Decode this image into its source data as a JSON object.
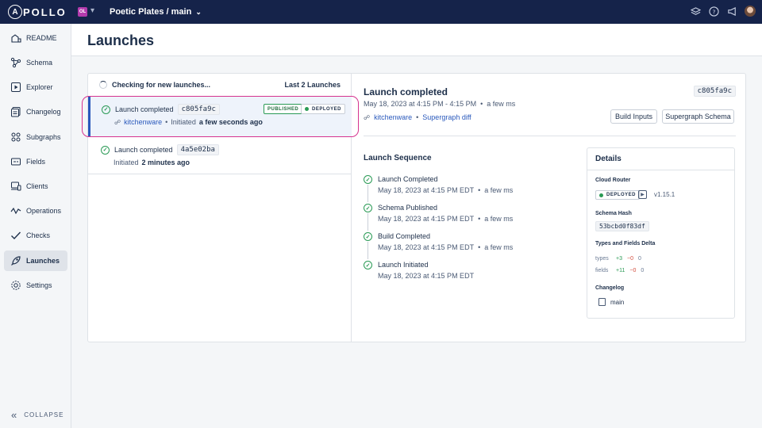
{
  "brand": {
    "logo_letter": "A",
    "logo_text": "POLLO"
  },
  "org": {
    "initials": "OL"
  },
  "graph": {
    "name": "Poetic Plates / main"
  },
  "sidebar": {
    "items": [
      {
        "label": "README",
        "icon": "readme-icon"
      },
      {
        "label": "Schema",
        "icon": "schema-icon"
      },
      {
        "label": "Explorer",
        "icon": "explorer-icon"
      },
      {
        "label": "Changelog",
        "icon": "changelog-icon"
      },
      {
        "label": "Subgraphs",
        "icon": "subgraphs-icon"
      },
      {
        "label": "Fields",
        "icon": "fields-icon"
      },
      {
        "label": "Clients",
        "icon": "clients-icon"
      },
      {
        "label": "Operations",
        "icon": "operations-icon"
      },
      {
        "label": "Checks",
        "icon": "checks-icon"
      },
      {
        "label": "Launches",
        "icon": "launches-icon",
        "active": true
      },
      {
        "label": "Settings",
        "icon": "settings-icon"
      }
    ],
    "collapse_label": "COLLAPSE"
  },
  "page": {
    "title": "Launches"
  },
  "list": {
    "status": "Checking for new launches...",
    "count_label": "Last 2 Launches",
    "launches": [
      {
        "title": "Launch completed",
        "hash": "c805fa9c",
        "badge_published": "PUBLISHED",
        "badge_deployed": "DEPLOYED",
        "subgraph": "kitchenware",
        "initiated_prefix": "Initiated",
        "initiated_time": "a few seconds ago"
      },
      {
        "title": "Launch completed",
        "hash": "4a5e02ba",
        "initiated_prefix": "Initiated",
        "initiated_time": "2 minutes ago"
      }
    ]
  },
  "detail": {
    "title": "Launch completed",
    "hash": "c805fa9c",
    "date_range": "May 18, 2023 at 4:15 PM - 4:15 PM",
    "ago": "a few ms",
    "subgraph": "kitchenware",
    "diff_link": "Supergraph diff",
    "build_inputs": "Build Inputs",
    "supergraph_schema": "Supergraph Schema",
    "sequence_title": "Launch Sequence",
    "sequence": [
      {
        "title": "Launch Completed",
        "date": "May 18, 2023 at 4:15 PM EDT",
        "ago": "a few ms"
      },
      {
        "title": "Schema Published",
        "date": "May 18, 2023 at 4:15 PM EDT",
        "ago": "a few ms"
      },
      {
        "title": "Build Completed",
        "date": "May 18, 2023 at 4:15 PM EDT",
        "ago": "a few ms"
      },
      {
        "title": "Launch Initiated",
        "date": "May 18, 2023 at 4:15 PM EDT",
        "ago": ""
      }
    ],
    "details_panel": {
      "title": "Details",
      "cloud_router_label": "Cloud Router",
      "deployed": "DEPLOYED",
      "version": "v1.15.1",
      "schema_hash_label": "Schema Hash",
      "schema_hash": "53bcbd0f83df",
      "delta_label": "Types and Fields Delta",
      "types": {
        "label": "types",
        "plus": "+3",
        "minus": "−0",
        "zero": "0"
      },
      "fields": {
        "label": "fields",
        "plus": "+11",
        "minus": "−0",
        "zero": "0"
      },
      "changelog_label": "Changelog",
      "changelog_item": "main"
    }
  }
}
